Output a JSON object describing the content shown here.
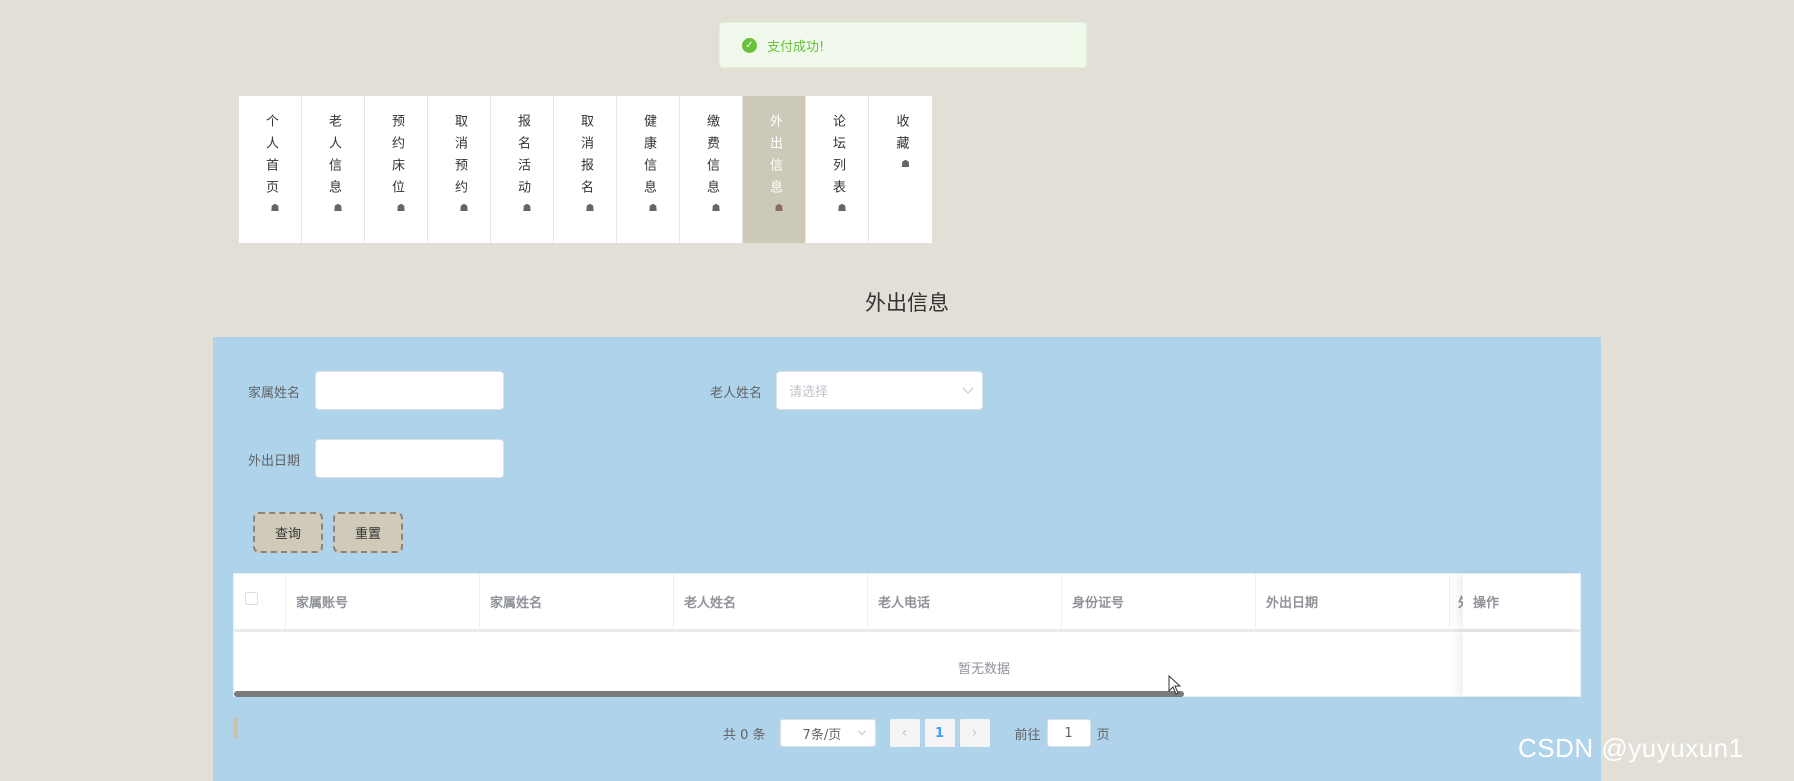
{
  "toast": {
    "message": "支付成功!"
  },
  "nav": {
    "items": [
      {
        "label": "个人首页",
        "active": false
      },
      {
        "label": "老人信息",
        "active": false
      },
      {
        "label": "预约床位",
        "active": false
      },
      {
        "label": "取消预约",
        "active": false
      },
      {
        "label": "报名活动",
        "active": false
      },
      {
        "label": "取消报名",
        "active": false
      },
      {
        "label": "健康信息",
        "active": false
      },
      {
        "label": "缴费信息",
        "active": false
      },
      {
        "label": "外出信息",
        "active": true
      },
      {
        "label": "论坛列表",
        "active": false
      },
      {
        "label": "收藏",
        "active": false
      }
    ],
    "icon": "home-icon"
  },
  "page": {
    "title": "外出信息"
  },
  "search": {
    "family_name_label": "家属姓名",
    "family_name_value": "",
    "elder_name_label": "老人姓名",
    "elder_name_placeholder": "请选择",
    "out_date_label": "外出日期",
    "out_date_value": "",
    "query_label": "查询",
    "reset_label": "重置"
  },
  "table": {
    "columns": [
      "家属账号",
      "家属姓名",
      "老人姓名",
      "老人电话",
      "身份证号",
      "外出日期"
    ],
    "truncated_column": "外",
    "fixed_column": "操作",
    "empty_text": "暂无数据"
  },
  "pagination": {
    "total_text": "共 0 条",
    "page_size": "7条/页",
    "prev": "‹",
    "current": "1",
    "next": "›",
    "jump_label": "前往",
    "jump_value": "1",
    "page_suffix": "页"
  },
  "watermark": "CSDN @yuyuxun1",
  "colors": {
    "background": "#e2dfd6",
    "panel": "#b0d3ec",
    "active_nav": "#cdc9b9",
    "success": "#67c23a",
    "primary": "#409eff"
  }
}
